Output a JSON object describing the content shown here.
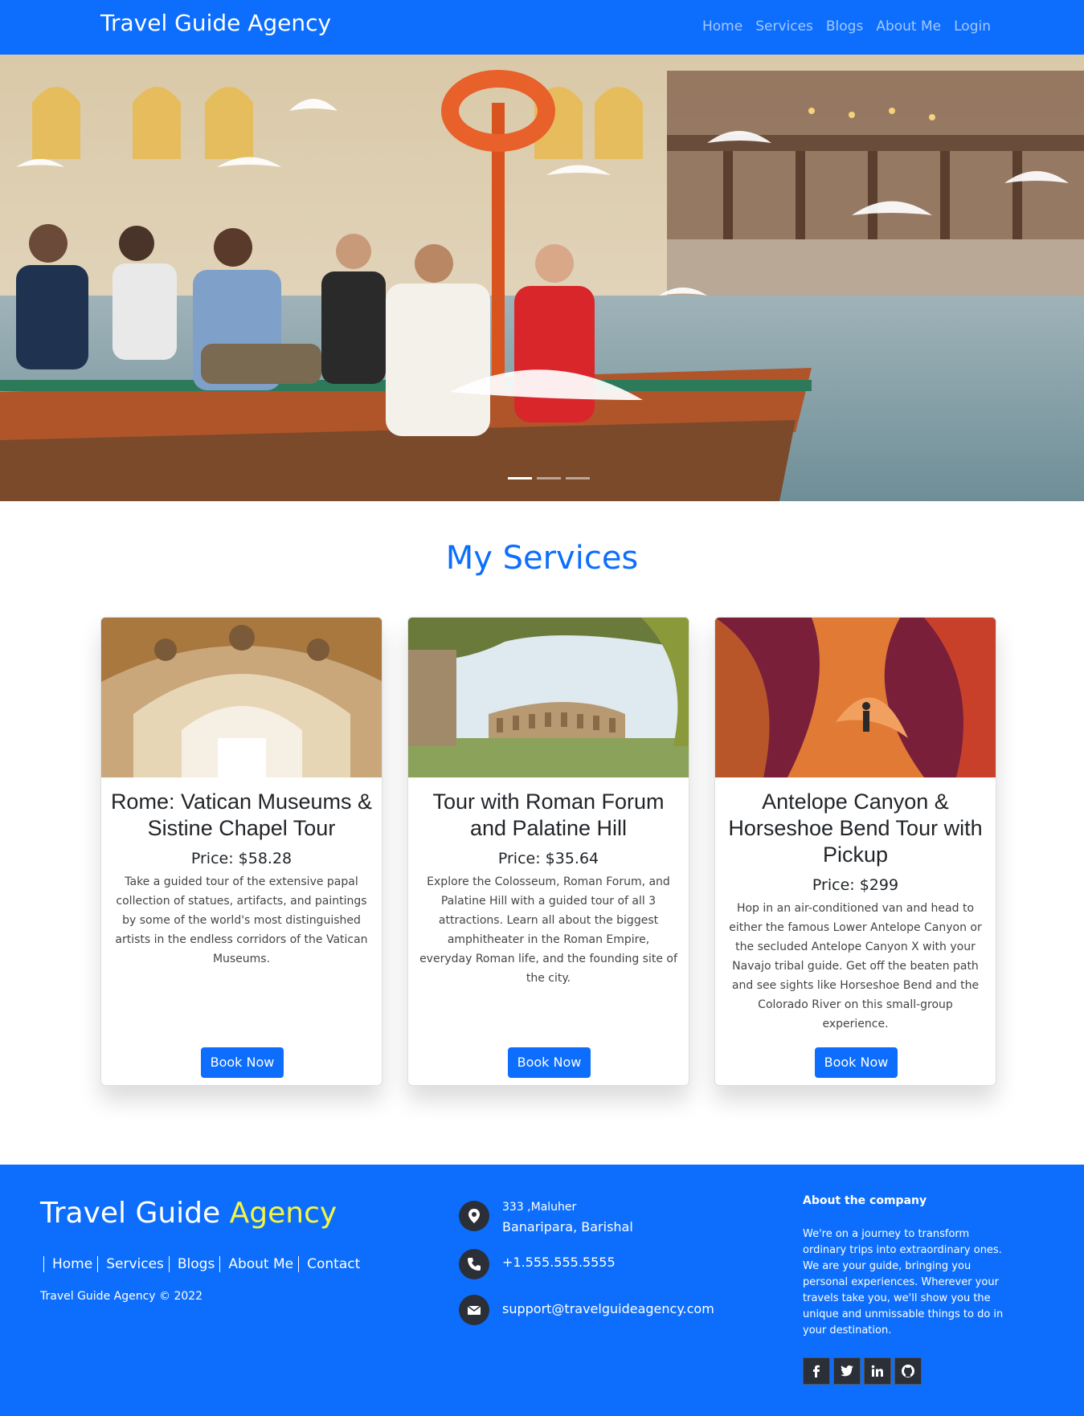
{
  "navbar": {
    "brand": "Travel Guide Agency",
    "links": [
      "Home",
      "Services",
      "Blogs",
      "About Me",
      "Login"
    ]
  },
  "services": {
    "title": "My Services",
    "cards": [
      {
        "title": "Rome: Vatican Museums & Sistine Chapel Tour",
        "price": "Price: $58.28",
        "description": "Take a guided tour of the extensive papal collection of statues, artifacts, and paintings by some of the world's most distinguished artists in the endless corridors of the Vatican Museums.",
        "button": "Book Now"
      },
      {
        "title": "Tour with Roman Forum and Palatine Hill",
        "price": "Price: $35.64",
        "description": "Explore the Colosseum, Roman Forum, and Palatine Hill with a guided tour of all 3 attractions. Learn all about the biggest amphitheater in the Roman Empire, everyday Roman life, and the founding site of the city.",
        "button": "Book Now"
      },
      {
        "title": "Antelope Canyon & Horseshoe Bend Tour with Pickup",
        "price": "Price: $299",
        "description": "Hop in an air-conditioned van and head to either the famous Lower Antelope Canyon or the secluded Antelope Canyon X with your Navajo tribal guide. Get off the beaten path and see sights like Horseshoe Bend and the Colorado River on this small-group experience.",
        "button": "Book Now"
      }
    ]
  },
  "footer": {
    "brand_main": "Travel Guide",
    "brand_accent": "Agency",
    "links": [
      "Home",
      "Services",
      "Blogs",
      "About Me",
      "Contact"
    ],
    "copyright": "Travel Guide Agency © 2022",
    "address_line1": "333 ,Maluher",
    "address_line2": "Banaripara, Barishal",
    "phone": "+1.555.555.5555",
    "email": "support@travelguideagency.com",
    "about_title": "About the company",
    "about_text": "We're on a journey to transform ordinary trips into extraordinary ones. We are your guide, bringing you personal experiences. Wherever your travels take you, we'll show you the unique and unmissable things to do in your destination."
  },
  "colors": {
    "primary": "#0d6efd",
    "accent": "#f5f542",
    "icon_bg": "#2b2f38"
  },
  "icons": [
    "location-icon",
    "phone-icon",
    "email-icon",
    "facebook-icon",
    "twitter-icon",
    "linkedin-icon",
    "github-icon"
  ]
}
